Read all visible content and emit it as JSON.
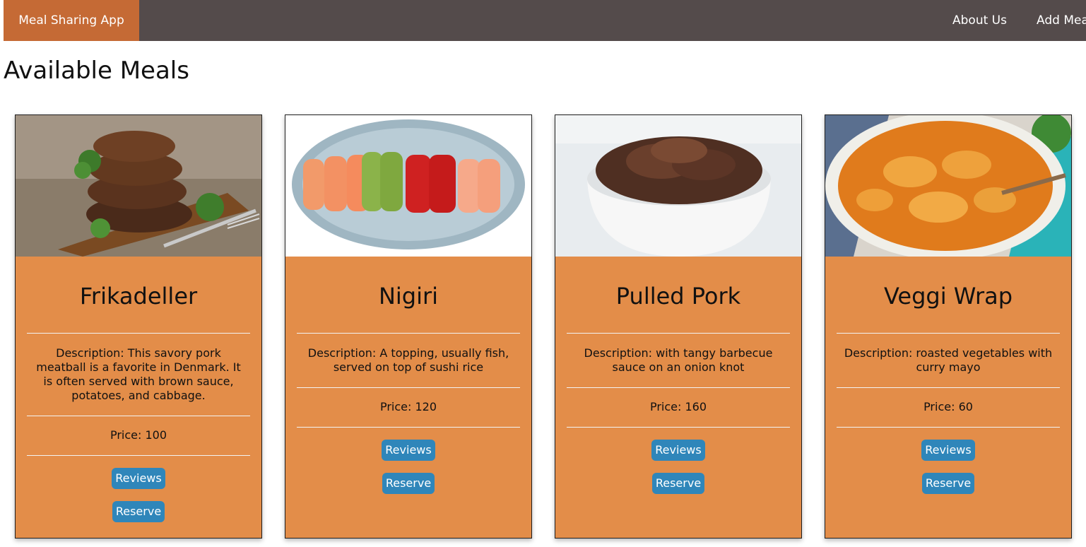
{
  "nav": {
    "brand": "Meal Sharing App",
    "links": [
      "About Us",
      "Add Meal"
    ]
  },
  "page_title": "Available Meals",
  "meals": [
    {
      "title": "Frikadeller",
      "description": "Description: This savory pork meatball is a favorite in Denmark. It is often served with brown sauce, potatoes, and cabbage.",
      "price": "Price: 100",
      "reviews_label": "Reviews",
      "reserve_label": "Reserve"
    },
    {
      "title": "Nigiri",
      "description": "Description: A topping, usually fish, served on top of sushi rice",
      "price": "Price: 120",
      "reviews_label": "Reviews",
      "reserve_label": "Reserve"
    },
    {
      "title": "Pulled Pork",
      "description": "Description: with tangy barbecue sauce on an onion knot",
      "price": "Price: 160",
      "reviews_label": "Reviews",
      "reserve_label": "Reserve"
    },
    {
      "title": "Veggi Wrap",
      "description": "Description: roasted vegetables with curry mayo",
      "price": "Price: 60",
      "reviews_label": "Reviews",
      "reserve_label": "Reserve"
    }
  ],
  "colors": {
    "navbar": "#544b4b",
    "brand": "#c56a35",
    "card": "#e38d49",
    "button": "#2f86ba"
  }
}
